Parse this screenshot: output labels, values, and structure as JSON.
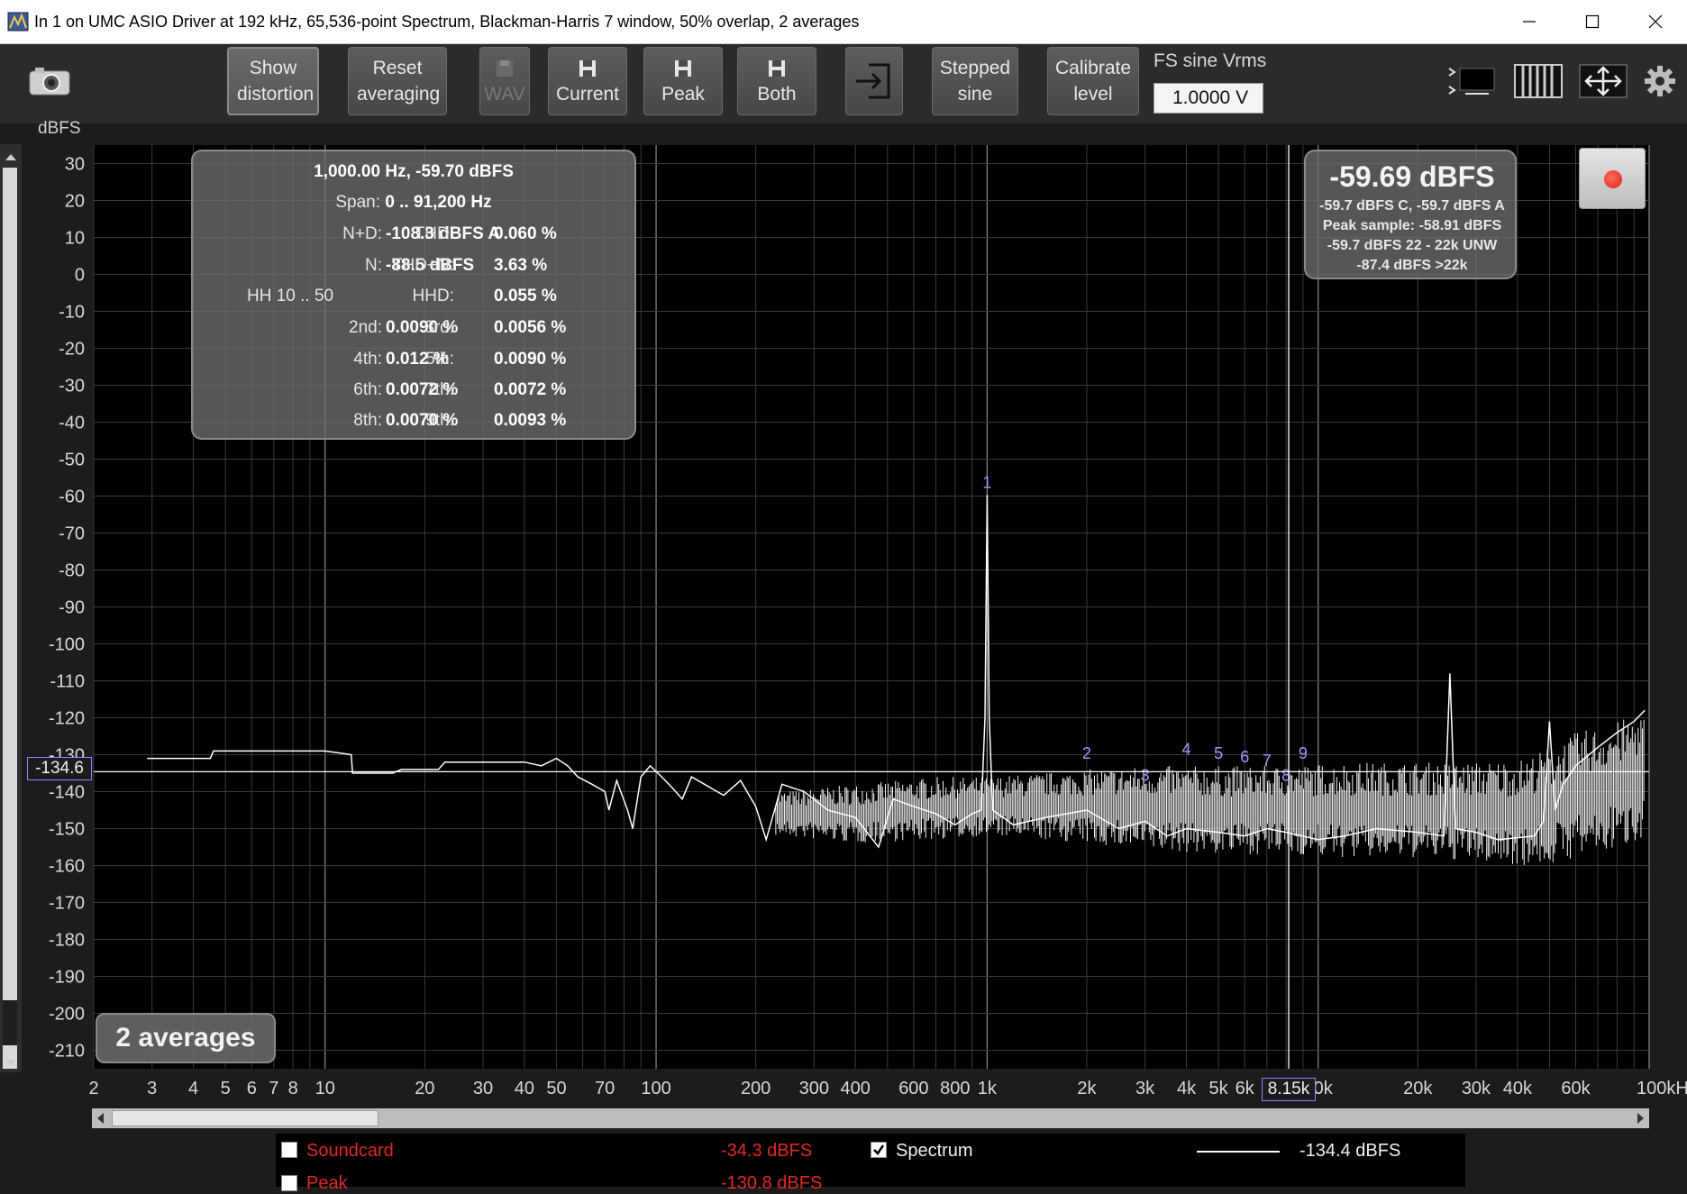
{
  "window": {
    "title": "In 1 on UMC ASIO Driver at 192 kHz, 65,536-point Spectrum, Blackman-Harris 7 window, 50% overlap, 2 averages",
    "controls": [
      "minimize",
      "maximize",
      "close"
    ]
  },
  "toolbar": {
    "camera_icon": "camera-icon",
    "show_distortion": "Show distortion",
    "reset_averaging": "Reset averaging",
    "wav": "WAV",
    "current": "Current",
    "peak": "Peak",
    "both": "Both",
    "import_icon": "import-icon",
    "stepped_sine": "Stepped sine",
    "calibrate_level": "Calibrate level",
    "fs_label": "FS sine Vrms",
    "fs_value": "1.0000 V",
    "right_icons": [
      "spectrum-view-icon",
      "bars-view-icon",
      "fit-icon",
      "gear-icon"
    ]
  },
  "distortion": {
    "header": "1,000.00 Hz, -59.70 dBFS",
    "span_label": "Span:",
    "span_value": "0 .. 91,200 Hz",
    "nd_label": "N+D:",
    "nd_value": "-108.3 dBFS A",
    "thd_label": "THD:",
    "thd_value": "0.060 %",
    "n_label": "N:",
    "n_value": "-88.5 dBFS",
    "thdn_label": "THD+N:",
    "thdn_value": "3.63 %",
    "hh_label": "HH 10 .. 50",
    "hhd_label": "HHD:",
    "hhd_value": "0.055 %",
    "h2_label": "2nd:",
    "h2_value": "0.0090 %",
    "h3_label": "3rd:",
    "h3_value": "0.0056 %",
    "h4_label": "4th:",
    "h4_value": "0.012 %",
    "h5_label": "5th:",
    "h5_value": "0.0090 %",
    "h6_label": "6th:",
    "h6_value": "0.0072 %",
    "h7_label": "7th:",
    "h7_value": "0.0072 %",
    "h8_label": "8th:",
    "h8_value": "0.0070 %",
    "h9_label": "9th:",
    "h9_value": "0.0093 %"
  },
  "level": {
    "big": "-59.69 dBFS",
    "line1": "-59.7 dBFS C, -59.7 dBFS A",
    "line2": "Peak sample: -58.91 dBFS",
    "line3": "-59.7 dBFS 22 - 22k UNW",
    "line4": "-87.4 dBFS >22k"
  },
  "averages_badge": "2 averages",
  "cursor": {
    "y_value": "-134.6",
    "x_value": "8.15k"
  },
  "legend": {
    "soundcard_label": "Soundcard",
    "soundcard_value": "-34.3 dBFS",
    "spectrum_label": "Spectrum",
    "spectrum_value": "-134.4 dBFS",
    "peak_label": "Peak",
    "peak_value": "-130.8 dBFS"
  },
  "colors": {
    "trace": "#ffffff",
    "background": "#1c1c1c",
    "grid": "#3d3d3d",
    "soundcard": "#e02828",
    "harmonic_marker": "#9a9aff"
  },
  "chart_data": {
    "type": "line",
    "title": "",
    "xlabel": "",
    "ylabel": "dBFS",
    "x_scale": "log",
    "xlim": [
      2,
      100000
    ],
    "ylim": [
      -215,
      35
    ],
    "x_tick_labels": [
      {
        "v": 2,
        "t": "2"
      },
      {
        "v": 3,
        "t": "3"
      },
      {
        "v": 4,
        "t": "4"
      },
      {
        "v": 5,
        "t": "5"
      },
      {
        "v": 6,
        "t": "6"
      },
      {
        "v": 7,
        "t": "7"
      },
      {
        "v": 8,
        "t": "8"
      },
      {
        "v": 10,
        "t": "10"
      },
      {
        "v": 20,
        "t": "20"
      },
      {
        "v": 30,
        "t": "30"
      },
      {
        "v": 40,
        "t": "40"
      },
      {
        "v": 50,
        "t": "50"
      },
      {
        "v": 70,
        "t": "70"
      },
      {
        "v": 100,
        "t": "100"
      },
      {
        "v": 200,
        "t": "200"
      },
      {
        "v": 300,
        "t": "300"
      },
      {
        "v": 400,
        "t": "400"
      },
      {
        "v": 600,
        "t": "600"
      },
      {
        "v": 800,
        "t": "800"
      },
      {
        "v": 1000,
        "t": "1k"
      },
      {
        "v": 2000,
        "t": "2k"
      },
      {
        "v": 3000,
        "t": "3k"
      },
      {
        "v": 4000,
        "t": "4k"
      },
      {
        "v": 5000,
        "t": "5k"
      },
      {
        "v": 6000,
        "t": "6k"
      },
      {
        "v": 10000,
        "t": "10k"
      },
      {
        "v": 20000,
        "t": "20k"
      },
      {
        "v": 30000,
        "t": "30k"
      },
      {
        "v": 40000,
        "t": "40k"
      },
      {
        "v": 60000,
        "t": "60k"
      },
      {
        "v": 100000,
        "t": "100kHz"
      }
    ],
    "y_ticks": [
      30,
      20,
      10,
      0,
      -10,
      -20,
      -30,
      -40,
      -50,
      -60,
      -70,
      -80,
      -90,
      -100,
      -110,
      -120,
      -130,
      -140,
      -150,
      -160,
      -170,
      -180,
      -190,
      -200,
      -210
    ],
    "series": [
      {
        "values": [
          [
            2.9,
            -131
          ],
          [
            4.5,
            -131
          ],
          [
            4.6,
            -129
          ],
          [
            10,
            -129
          ],
          [
            12,
            -130
          ],
          [
            12.1,
            -135
          ],
          [
            16,
            -135
          ],
          [
            17,
            -134
          ],
          [
            22,
            -134
          ],
          [
            23,
            -132
          ],
          [
            40,
            -132
          ],
          [
            45,
            -133
          ],
          [
            50,
            -131
          ],
          [
            54,
            -133
          ],
          [
            58,
            -136
          ],
          [
            64,
            -138
          ],
          [
            70,
            -140
          ],
          [
            72,
            -145
          ],
          [
            76,
            -137
          ],
          [
            82,
            -145
          ],
          [
            85,
            -150
          ],
          [
            90,
            -136
          ],
          [
            96,
            -133
          ],
          [
            104,
            -136
          ],
          [
            112,
            -139
          ],
          [
            120,
            -142
          ],
          [
            128,
            -136
          ],
          [
            140,
            -138
          ],
          [
            160,
            -141
          ],
          [
            180,
            -137
          ],
          [
            200,
            -144
          ],
          [
            215,
            -153
          ],
          [
            240,
            -138
          ],
          [
            280,
            -140
          ],
          [
            330,
            -145
          ],
          [
            400,
            -147
          ],
          [
            470,
            -155
          ],
          [
            520,
            -142
          ],
          [
            600,
            -144
          ],
          [
            700,
            -146
          ],
          [
            800,
            -149
          ],
          [
            900,
            -146
          ],
          [
            960,
            -145
          ],
          [
            985,
            -120
          ],
          [
            1000,
            -59.7
          ],
          [
            1015,
            -120
          ],
          [
            1040,
            -145
          ],
          [
            1200,
            -149
          ],
          [
            1500,
            -147
          ],
          [
            2000,
            -145
          ],
          [
            2500,
            -150
          ],
          [
            3000,
            -148
          ],
          [
            3500,
            -152
          ],
          [
            4000,
            -150
          ],
          [
            5000,
            -151
          ],
          [
            6000,
            -152
          ],
          [
            7000,
            -150
          ],
          [
            8000,
            -151
          ],
          [
            10000,
            -153
          ],
          [
            12000,
            -152
          ],
          [
            15000,
            -150
          ],
          [
            20000,
            -151
          ],
          [
            24000,
            -152
          ],
          [
            25000,
            -108
          ],
          [
            26000,
            -150
          ],
          [
            30000,
            -151
          ],
          [
            35000,
            -153
          ],
          [
            45000,
            -152
          ],
          [
            48000,
            -148
          ],
          [
            50000,
            -121
          ],
          [
            52000,
            -145
          ],
          [
            55000,
            -138
          ],
          [
            60000,
            -133
          ],
          [
            70000,
            -128
          ],
          [
            80000,
            -124
          ],
          [
            90000,
            -121
          ],
          [
            97000,
            -118
          ]
        ]
      }
    ],
    "noise_envelope": [
      [
        230,
        -140,
        -152
      ],
      [
        400,
        -138,
        -154
      ],
      [
        700,
        -136,
        -153
      ],
      [
        1000,
        -136,
        -152
      ],
      [
        2000,
        -134,
        -154
      ],
      [
        3000,
        -133,
        -156
      ],
      [
        5000,
        -133,
        -157
      ],
      [
        8000,
        -133,
        -157
      ],
      [
        12000,
        -132,
        -158
      ],
      [
        20000,
        -132,
        -158
      ],
      [
        30000,
        -132,
        -159
      ],
      [
        42000,
        -131,
        -160
      ],
      [
        50000,
        -128,
        -160
      ],
      [
        60000,
        -124,
        -158
      ],
      [
        80000,
        -121,
        -156
      ],
      [
        97000,
        -118,
        -152
      ]
    ],
    "harmonic_markers": [
      {
        "label": "1",
        "x": 1000,
        "y": -59.7
      },
      {
        "label": "2",
        "x": 2000,
        "y": -133
      },
      {
        "label": "3",
        "x": 3000,
        "y": -139
      },
      {
        "label": "4",
        "x": 4000,
        "y": -132
      },
      {
        "label": "5",
        "x": 5000,
        "y": -133
      },
      {
        "label": "6",
        "x": 6000,
        "y": -134
      },
      {
        "label": "7",
        "x": 7000,
        "y": -135
      },
      {
        "label": "8",
        "x": 8000,
        "y": -139
      },
      {
        "label": "9",
        "x": 9000,
        "y": -133
      }
    ],
    "cursor_x": 8150,
    "cursor_y": -134.6,
    "grid": true,
    "legend": "bottom"
  }
}
